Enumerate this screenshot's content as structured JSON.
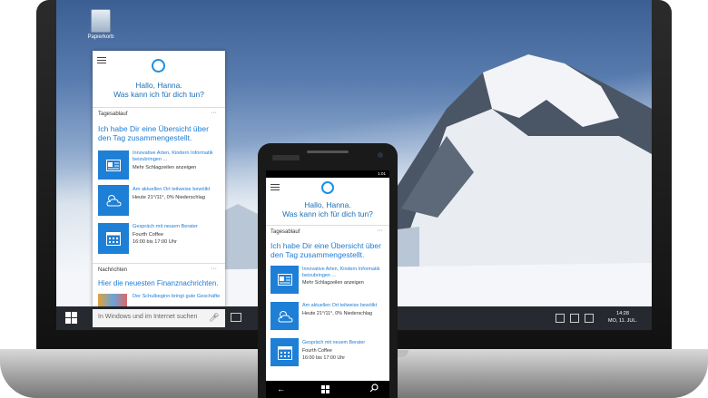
{
  "desktop": {
    "recycle_bin_label": "Papierkorb",
    "cortana": {
      "greeting_line1": "Hallo, Hanna.",
      "greeting_line2": "Was kann ich für dich tun?",
      "section_daily": "Tagesablauf",
      "section_more": "···",
      "headline": "Ich habe Dir eine Übersicht über den Tag zusammengestellt.",
      "cards": [
        {
          "title": "Innovative Arten, Kindern Informatik beizubringen ...",
          "detail": "Mehr Schlagzeilen anzeigen",
          "icon": "news-icon"
        },
        {
          "title": "Am aktuellen Ort teilweise bewölkt",
          "detail": "Heute 21°/11°, 0% Niederschlag",
          "icon": "weather-icon"
        },
        {
          "title": "Gespräch mit neuem Berater",
          "detail": "Fourth Coffee\n16:00 bis 17:00 Uhr",
          "icon": "calendar-icon"
        }
      ],
      "section_news": "Nachrichten",
      "news_headline": "Hier die neuesten Finanznachrichten.",
      "news_item": "Der Schulbeginn bringt gute Geschäfte"
    },
    "taskbar": {
      "search_placeholder": "In Windows und im Internet suchen",
      "time": "14:28",
      "date": "MO, 11. JUL."
    }
  },
  "phone": {
    "status_time": "1:01",
    "cortana": {
      "greeting_line1": "Hallo, Hanna.",
      "greeting_line2": "Was kann ich für dich tun?",
      "section_daily": "Tagesablauf",
      "section_more": "···",
      "headline": "Ich habe Dir eine Übersicht über den Tag zusammengestellt.",
      "cards": [
        {
          "title": "Innovative Arten, Kindern Informatik beizubringen ...",
          "detail": "Mehr Schlagzeilen anzeigen",
          "icon": "news-icon"
        },
        {
          "title": "Am aktuellen Ort teilweise bewölkt",
          "detail": "Heute 21°/11°, 0% Niederschlag",
          "icon": "weather-icon"
        },
        {
          "title": "Gespräch mit neuem Berater",
          "detail": "Fourth Coffee\n16:00 bis 17:00 Uhr",
          "icon": "calendar-icon"
        }
      ]
    }
  },
  "colors": {
    "accent": "#1e7fd6",
    "taskbar": "#14181e"
  }
}
